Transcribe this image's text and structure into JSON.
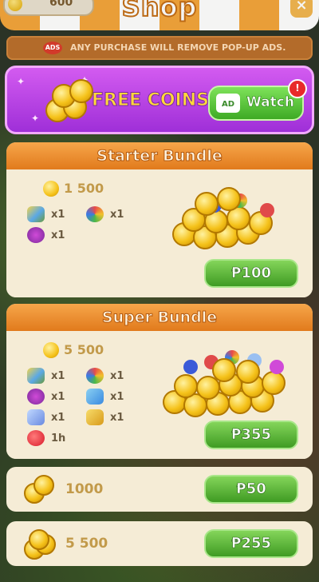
{
  "header": {
    "coin_balance": "600",
    "title": "Shop",
    "close_label": "×"
  },
  "notice": {
    "ads_badge": "ADS",
    "text": "ANY PURCHASE WILL REMOVE POP-UP ADS."
  },
  "free_coins": {
    "label": "FREE COINS",
    "ad_chip": "AD",
    "button_label": "Watch",
    "alert": "!"
  },
  "bundles": [
    {
      "title": "Starter Bundle",
      "coins": "1 500",
      "items": [
        {
          "icon": "spinner-booster-icon",
          "qty": "x1"
        },
        {
          "icon": "ball-booster-icon",
          "qty": "x1"
        },
        {
          "icon": "berries-booster-icon",
          "qty": "x1"
        }
      ],
      "price": "₱100"
    },
    {
      "title": "Super Bundle",
      "coins": "5 500",
      "items": [
        {
          "icon": "spinner-booster-icon",
          "qty": "x1"
        },
        {
          "icon": "ball-booster-icon",
          "qty": "x1"
        },
        {
          "icon": "berries-booster-icon",
          "qty": "x1"
        },
        {
          "icon": "plane-booster-icon",
          "qty": "x1"
        },
        {
          "icon": "star-booster-icon",
          "qty": "x1"
        },
        {
          "icon": "glove-booster-icon",
          "qty": "x1"
        },
        {
          "icon": "heart-icon",
          "qty": "1h"
        }
      ],
      "price": "₱355"
    }
  ],
  "coin_packs": [
    {
      "amount": "1000",
      "price": "₱50"
    },
    {
      "amount": "5 500",
      "price": "₱255"
    }
  ]
}
